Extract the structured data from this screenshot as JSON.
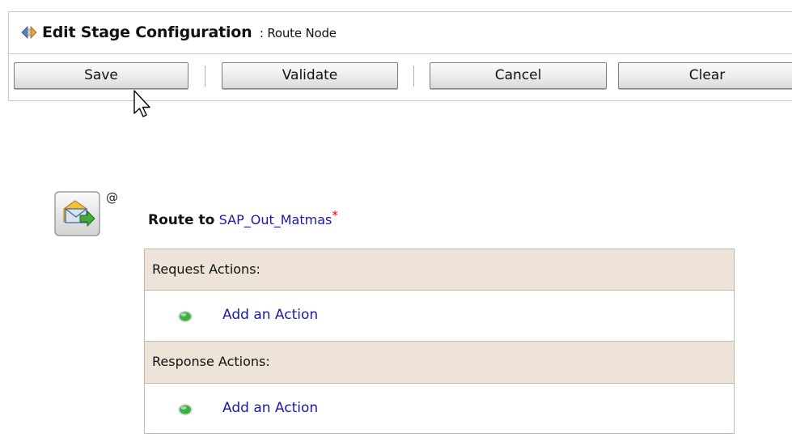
{
  "header": {
    "title": "Edit Stage Configuration",
    "separator": ":",
    "subtitle": "Route Node",
    "icon": "stage-config-icon"
  },
  "toolbar": {
    "save_label": "Save",
    "validate_label": "Validate",
    "cancel_label": "Cancel",
    "clear_label": "Clear"
  },
  "route": {
    "icon": "route-envelope-icon",
    "at_symbol": "@",
    "label": "Route to",
    "target": "SAP_Out_Matmas",
    "required_marker": "*"
  },
  "actions": {
    "request_header": "Request Actions:",
    "request_add_label": "Add an Action",
    "response_header": "Response Actions:",
    "response_add_label": "Add an Action"
  },
  "colors": {
    "link": "#1a1aa8",
    "required": "#e00000",
    "section_header_bg": "#ede3d8",
    "status_dot": "#3cb043"
  }
}
